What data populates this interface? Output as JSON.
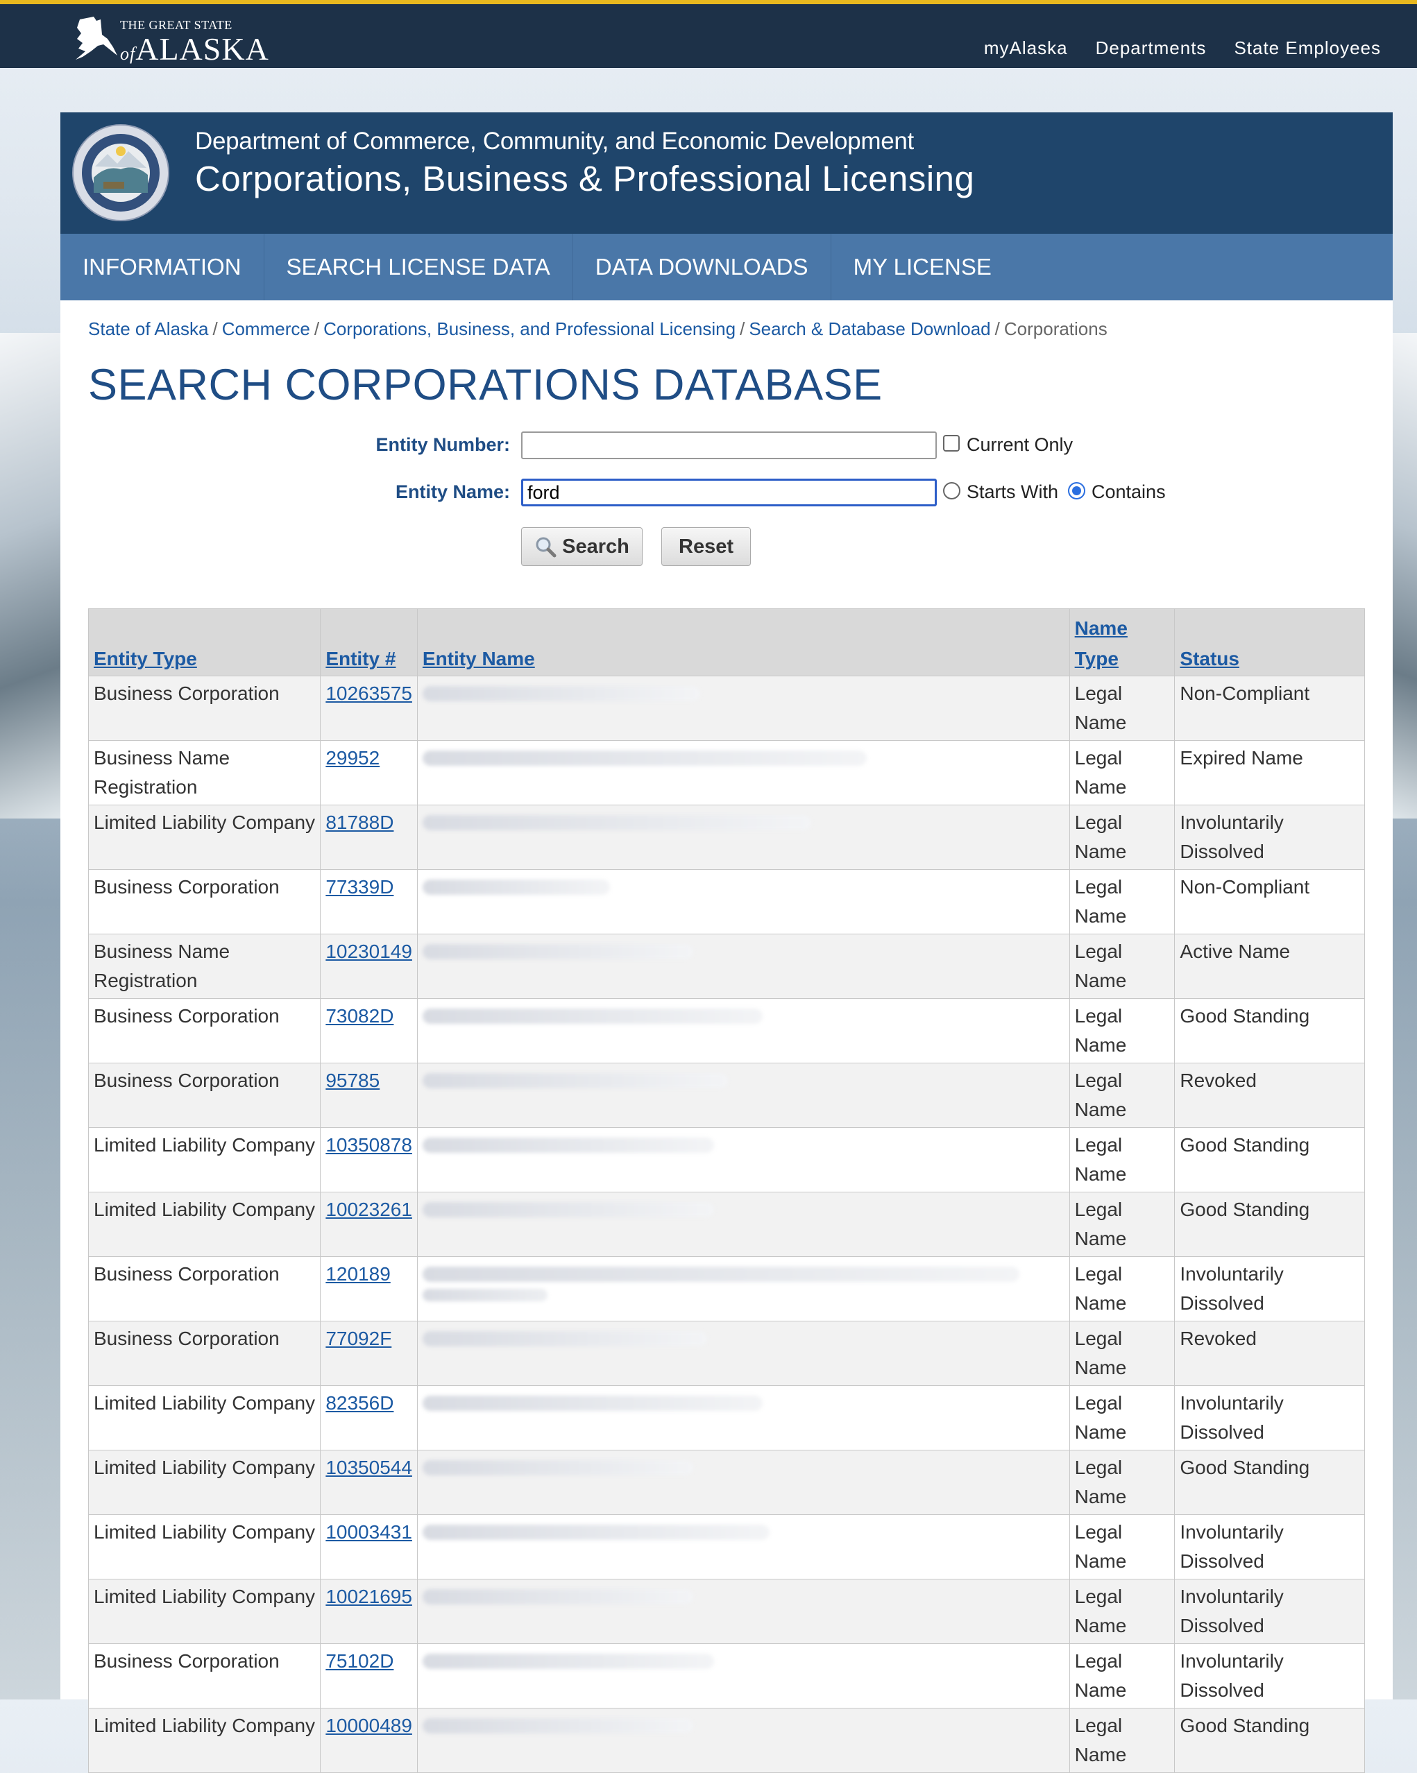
{
  "topbar": {
    "logo_small": "THE GREAT STATE",
    "logo_of": "of",
    "logo_big": "ALASKA",
    "links": [
      "myAlaska",
      "Departments",
      "State Employees"
    ]
  },
  "banner": {
    "department": "Department of Commerce, Community, and Economic Development",
    "division": "Corporations, Business & Professional Licensing"
  },
  "nav": [
    "INFORMATION",
    "SEARCH LICENSE DATA",
    "DATA DOWNLOADS",
    "MY LICENSE"
  ],
  "breadcrumb": {
    "links": [
      "State of Alaska",
      "Commerce",
      "Corporations, Business, and Professional Licensing",
      "Search & Database Download"
    ],
    "current": "Corporations"
  },
  "page_title": "SEARCH CORPORATIONS DATABASE",
  "form": {
    "entity_number_label": "Entity Number:",
    "entity_number_value": "",
    "current_only_label": "Current Only",
    "entity_name_label": "Entity Name:",
    "entity_name_value": "ford",
    "starts_with_label": "Starts With",
    "contains_label": "Contains",
    "match_mode": "Contains",
    "search_button": "Search",
    "reset_button": "Reset"
  },
  "table": {
    "headers": {
      "entity_type": "Entity Type",
      "entity_number": "Entity #",
      "entity_name": "Entity Name",
      "name_type": "Name Type",
      "status": "Status"
    },
    "rows": [
      {
        "type": "Business Corporation",
        "number": "10263575",
        "name_type": "Legal Name",
        "status": "Non-Compliant"
      },
      {
        "type": "Business Name Registration",
        "number": "29952",
        "name_type": "Legal Name",
        "status": "Expired Name"
      },
      {
        "type": "Limited Liability Company",
        "number": "81788D",
        "name_type": "Legal Name",
        "status": "Involuntarily Dissolved"
      },
      {
        "type": "Business Corporation",
        "number": "77339D",
        "name_type": "Legal Name",
        "status": "Non-Compliant"
      },
      {
        "type": "Business Name Registration",
        "number": "10230149",
        "name_type": "Legal Name",
        "status": "Active Name"
      },
      {
        "type": "Business Corporation",
        "number": "73082D",
        "name_type": "Legal Name",
        "status": "Good Standing"
      },
      {
        "type": "Business Corporation",
        "number": "95785",
        "name_type": "Legal Name",
        "status": "Revoked"
      },
      {
        "type": "Limited Liability Company",
        "number": "10350878",
        "name_type": "Legal Name",
        "status": "Good Standing"
      },
      {
        "type": "Limited Liability Company",
        "number": "10023261",
        "name_type": "Legal Name",
        "status": "Good Standing"
      },
      {
        "type": "Business Corporation",
        "number": "120189",
        "name_type": "Legal Name",
        "status": "Involuntarily Dissolved"
      },
      {
        "type": "Business Corporation",
        "number": "77092F",
        "name_type": "Legal Name",
        "status": "Revoked"
      },
      {
        "type": "Limited Liability Company",
        "number": "82356D",
        "name_type": "Legal Name",
        "status": "Involuntarily Dissolved"
      },
      {
        "type": "Limited Liability Company",
        "number": "10350544",
        "name_type": "Legal Name",
        "status": "Good Standing"
      },
      {
        "type": "Limited Liability Company",
        "number": "10003431",
        "name_type": "Legal Name",
        "status": "Involuntarily Dissolved"
      },
      {
        "type": "Limited Liability Company",
        "number": "10021695",
        "name_type": "Legal Name",
        "status": "Involuntarily Dissolved"
      },
      {
        "type": "Business Corporation",
        "number": "75102D",
        "name_type": "Legal Name",
        "status": "Involuntarily Dissolved"
      },
      {
        "type": "Limited Liability Company",
        "number": "10000489",
        "name_type": "Legal Name",
        "status": "Good Standing"
      }
    ]
  }
}
